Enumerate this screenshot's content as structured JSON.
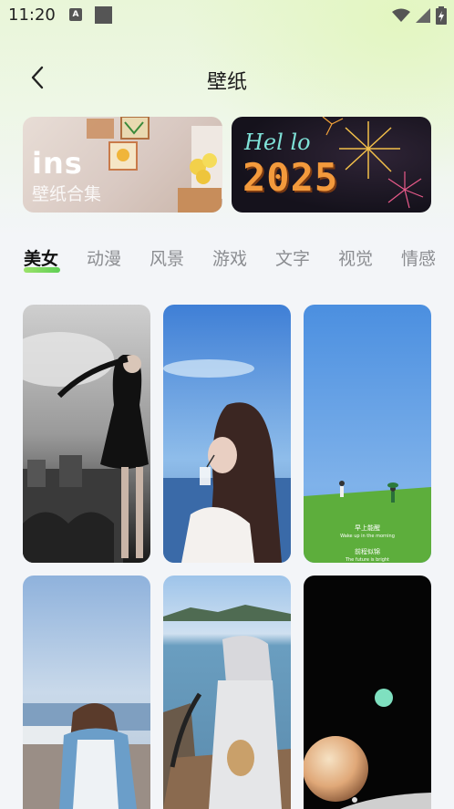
{
  "status": {
    "time": "11:20"
  },
  "header": {
    "title": "壁纸"
  },
  "banners": [
    {
      "brand": "ins",
      "subtitle": "壁纸合集"
    },
    {
      "line1": "Hel lo",
      "line2": "2025"
    }
  ],
  "tabs": [
    "美女",
    "动漫",
    "风景",
    "游戏",
    "文字",
    "视觉",
    "情感"
  ],
  "active_tab": "美女",
  "wallpaper_texts": {
    "line1": "早上能醒",
    "line2": "Wake up in the morning",
    "line3": "前程似锦",
    "line4": "The future is bright"
  },
  "colors": {
    "accent_green": "#7ed957",
    "title": "#1a1a1a",
    "tab_inactive": "#8b8d91"
  }
}
